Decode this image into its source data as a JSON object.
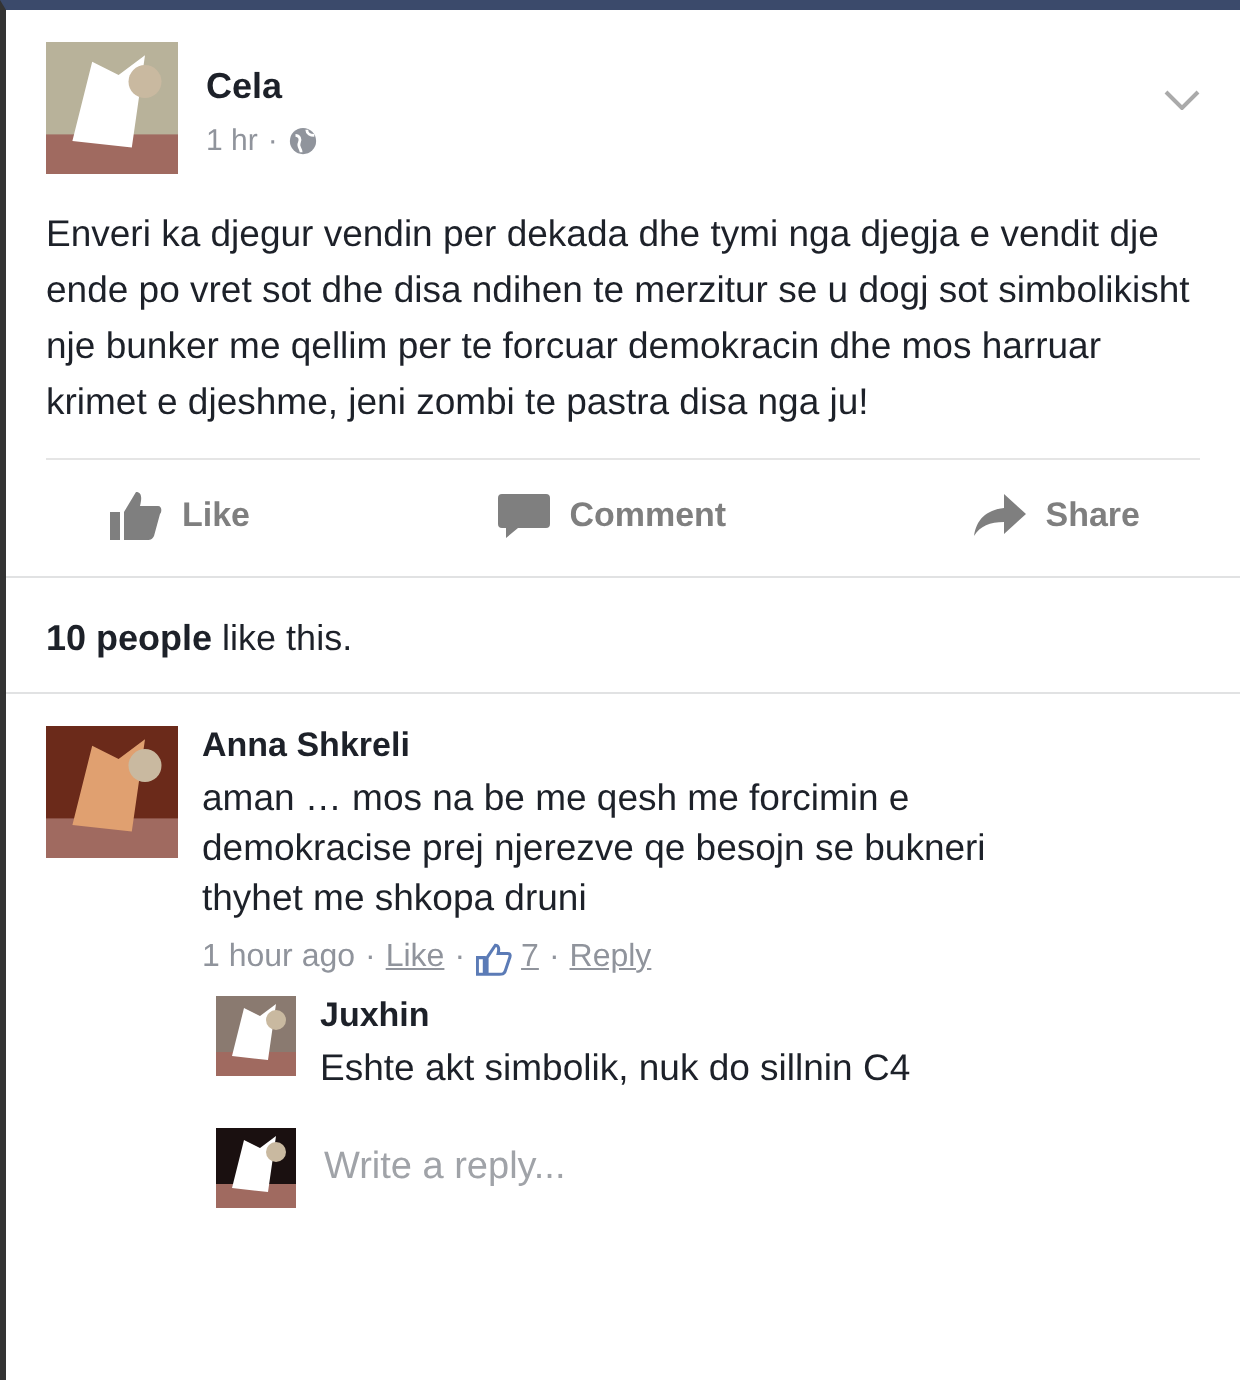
{
  "post": {
    "author": "Cela",
    "time": "1 hr",
    "separator": "·",
    "text": "Enveri ka djegur vendin per dekada dhe tymi nga djegja e vendit dje ende po vret sot dhe disa ndihen te merzitur se u dogj sot simbolikisht nje bunker me qellim per te forcuar demokracin dhe mos harruar krimet e djeshme, jeni zombi te pastra disa nga ju!"
  },
  "actions": [
    "Like",
    "Comment",
    "Share"
  ],
  "likes": {
    "count": "10 people",
    "rest": "like this."
  },
  "comment": {
    "author": "Anna Shkreli",
    "text": "aman … mos na be me qesh me forcimin e demokracise prej njerezve qe besojn se bukneri thyhet me shkopa druni",
    "time": "1 hour ago",
    "separators": [
      "·",
      "·",
      "·"
    ],
    "like": "Like",
    "reactions": "7",
    "reply": "Reply"
  },
  "reply": {
    "author": "Juxhin",
    "text": "Eshte akt simbolik, nuk do sillnin C4"
  },
  "reply_box": {
    "placeholder": "Write a reply..."
  }
}
